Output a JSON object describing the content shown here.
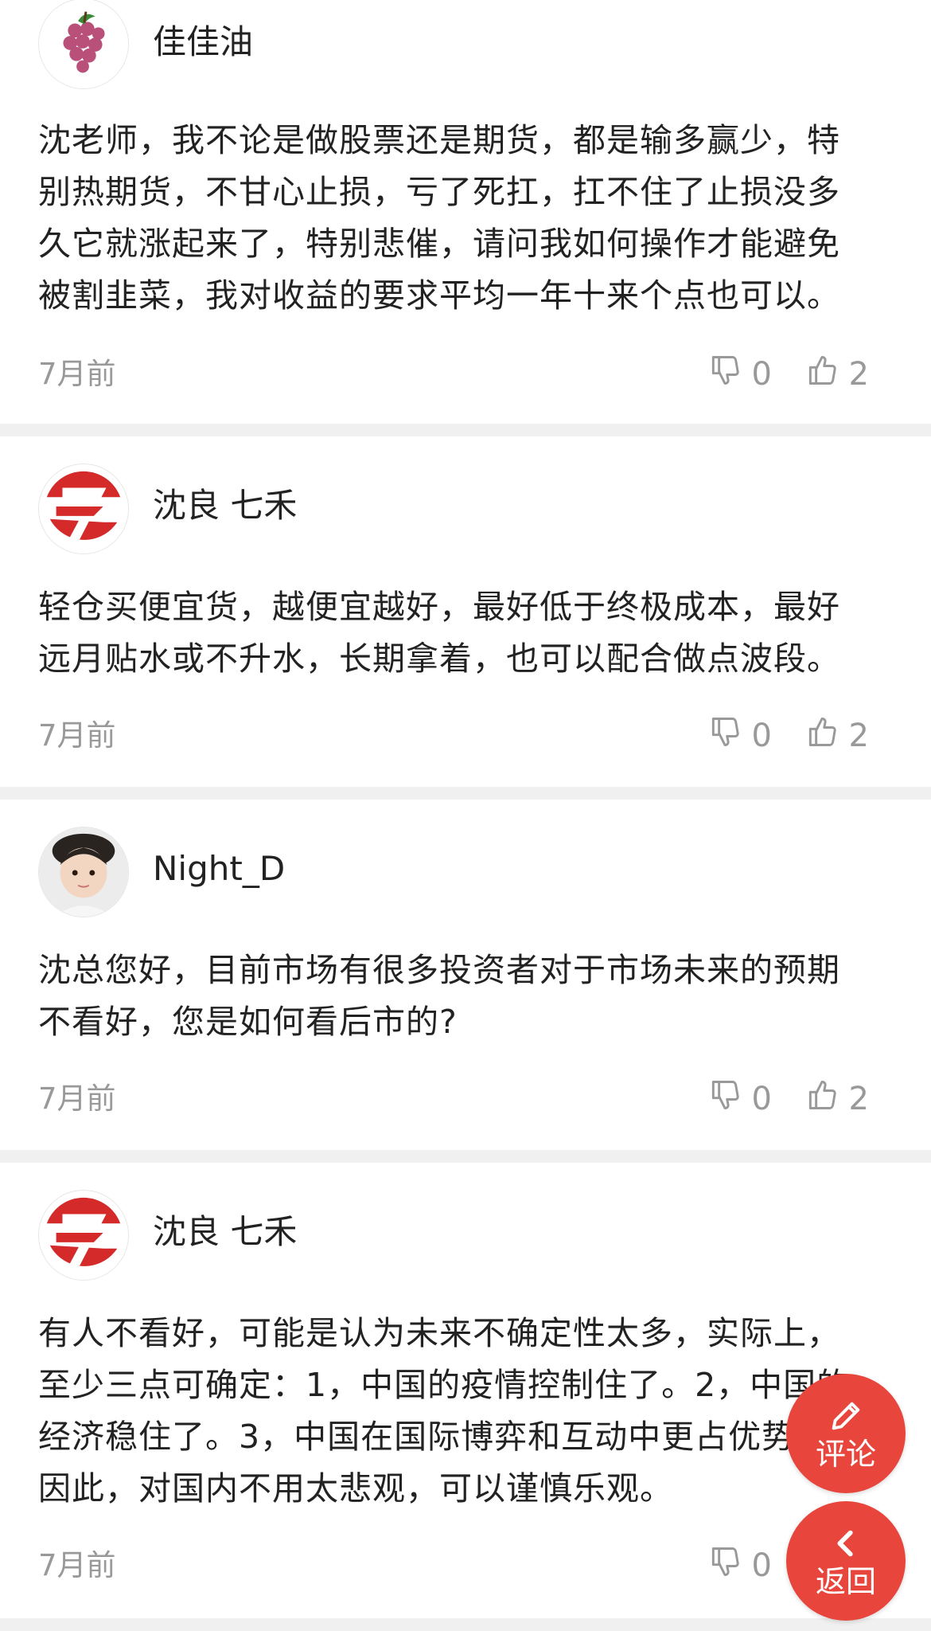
{
  "comments": [
    {
      "username": "佳佳油",
      "lines": [
        "沈老师，我不论是做股票还是期货，都是输多赢少，特",
        "别热期货，不甘心止损，亏了死扛，扛不住了止损没多",
        "久它就涨起来了，特别悲催，请问我如何操作才能避免",
        "被割韭菜，我对收益的要求平均一年十来个点也可以。"
      ],
      "time": "7月前",
      "dislikes": "0",
      "likes": "2"
    },
    {
      "username": "沈良 七禾",
      "lines": [
        "轻仓买便宜货，越便宜越好，最好低于终极成本，最好",
        "远月贴水或不升水，长期拿着，也可以配合做点波段。"
      ],
      "time": "7月前",
      "dislikes": "0",
      "likes": "2"
    },
    {
      "username": "Night_D",
      "lines": [
        "沈总您好，目前市场有很多投资者对于市场未来的预期",
        "不看好，您是如何看后市的?"
      ],
      "time": "7月前",
      "dislikes": "0",
      "likes": "2"
    },
    {
      "username": "沈良 七禾",
      "lines": [
        "有人不看好，可能是认为未来不确定性太多，实际上，",
        "至少三点可确定：1，中国的疫情控制住了。2，中国的",
        "经济稳住了。3，中国在国际博弈和互动中更占优势。",
        "因此，对国内不用太悲观，可以谨慎乐观。"
      ],
      "time": "7月前",
      "dislikes": "0",
      "likes": ""
    }
  ],
  "fab": {
    "comment_label": "评论",
    "back_label": "返回",
    "color": "#e8453c"
  },
  "icons": {
    "like": "thumbs-up-icon",
    "dislike": "thumbs-down-icon",
    "comment": "pencil-icon",
    "back": "chevron-left-icon"
  }
}
